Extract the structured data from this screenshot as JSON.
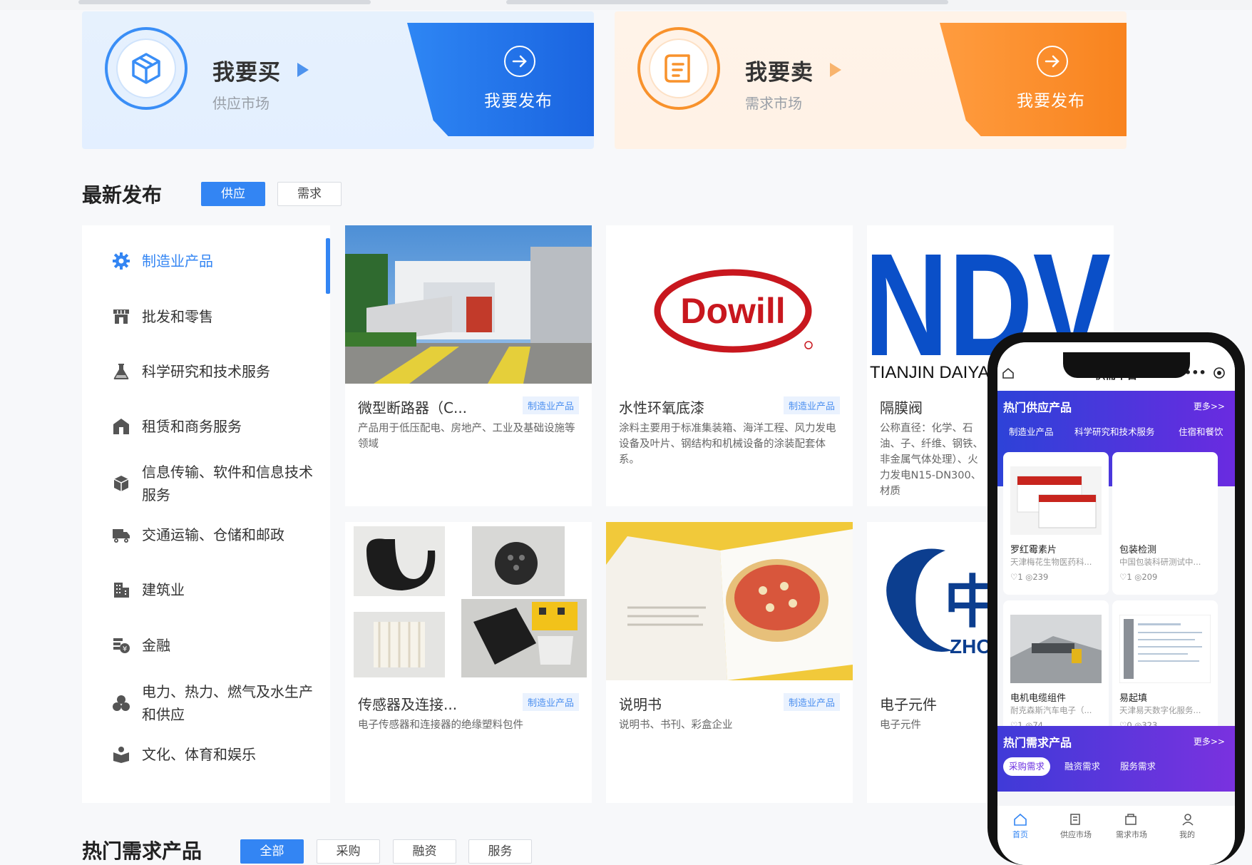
{
  "buy": {
    "title": "我要买",
    "subtitle": "供应市场",
    "cta": "我要发布"
  },
  "sell": {
    "title": "我要卖",
    "subtitle": "需求市场",
    "cta": "我要发布"
  },
  "latest": {
    "title": "最新发布",
    "tabs": [
      "供应",
      "需求"
    ]
  },
  "sidebar": [
    {
      "label": "制造业产品",
      "icon": "gear-icon"
    },
    {
      "label": "批发和零售",
      "icon": "store-icon"
    },
    {
      "label": "科学研究和技术服务",
      "icon": "flask-icon"
    },
    {
      "label": "租赁和商务服务",
      "icon": "house-icon"
    },
    {
      "label": "信息传输、软件和信息技术服务",
      "icon": "cube-icon"
    },
    {
      "label": "交通运输、仓储和邮政",
      "icon": "truck-icon"
    },
    {
      "label": "建筑业",
      "icon": "building-icon"
    },
    {
      "label": "金融",
      "icon": "finance-icon"
    },
    {
      "label": "电力、热力、燃气及水生产和供应",
      "icon": "energy-icon"
    },
    {
      "label": "文化、体育和娱乐",
      "icon": "culture-icon"
    }
  ],
  "cards": [
    {
      "name": "微型断路器（C...",
      "tag": "制造业产品",
      "desc": "产品用于低压配电、房地产、工业及基础设施等领域"
    },
    {
      "name": "水性环氧底漆",
      "tag": "制造业产品",
      "desc": "涂料主要用于标准集装箱、海洋工程、风力发电设备及叶片、钢结构和机械设备的涂装配套体系。",
      "logo": "Dowill"
    },
    {
      "name": "隔膜阀",
      "tag": "",
      "desc": "公称直径：化学、石油、子、纤维、钢铁、非金属气体处理）、火力发电N15-DN300、材质",
      "logo": "NDV",
      "logo_sub": "TIANJIN DAIYA"
    },
    {
      "name": "传感器及连接...",
      "tag": "制造业产品",
      "desc": "电子传感器和连接器的绝缘塑料包件"
    },
    {
      "name": "说明书",
      "tag": "制造业产品",
      "desc": "说明书、书刊、彩盒企业"
    },
    {
      "name": "电子元件",
      "tag": "",
      "desc": "电子元件",
      "logo": "中",
      "logo_sub": "ZHON"
    }
  ],
  "hot_demand": {
    "title": "热门需求产品",
    "tabs": [
      "全部",
      "采购",
      "融资",
      "服务"
    ]
  },
  "phone": {
    "app_title": "供需平台",
    "hot_supply_title": "热门供应产品",
    "more": "更多>>",
    "categories": [
      "制造业产品",
      "科学研究和技术服务",
      "住宿和餐饮"
    ],
    "items": [
      {
        "name": "罗红霉素片",
        "company": "天津梅花生物医药科...",
        "likes": "1",
        "views": "239"
      },
      {
        "name": "包装检测",
        "company": "中国包装科研测试中...",
        "likes": "1",
        "views": "209"
      },
      {
        "name": "电机电缆组件",
        "company": "耐克森斯汽车电子（...",
        "likes": "1",
        "views": "74"
      },
      {
        "name": "易起填",
        "company": "天津易天数字化服务...",
        "likes": "0",
        "views": "323"
      }
    ],
    "hot_demand_title": "热门需求产品",
    "demand_chips": [
      "采购需求",
      "融资需求",
      "服务需求"
    ],
    "tabbar": [
      "首页",
      "供应市场",
      "需求市场",
      "我的"
    ]
  }
}
